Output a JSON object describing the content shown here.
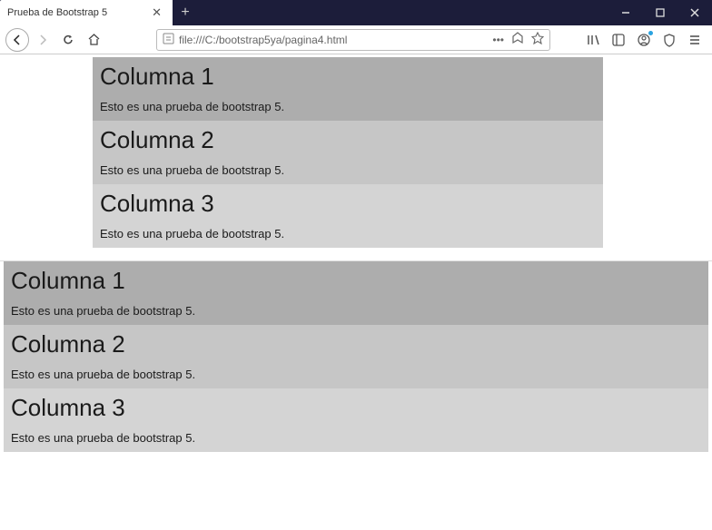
{
  "window": {
    "tab_title": "Prueba de Bootstrap 5",
    "url": "file:///C:/bootstrap5ya/pagina4.html"
  },
  "group1": {
    "cols": [
      {
        "title": "Columna 1",
        "text": "Esto es una prueba de bootstrap 5."
      },
      {
        "title": "Columna 2",
        "text": "Esto es una prueba de bootstrap 5."
      },
      {
        "title": "Columna 3",
        "text": "Esto es una prueba de bootstrap 5."
      }
    ]
  },
  "group2": {
    "cols": [
      {
        "title": "Columna 1",
        "text": "Esto es una prueba de bootstrap 5."
      },
      {
        "title": "Columna 2",
        "text": "Esto es una prueba de bootstrap 5."
      },
      {
        "title": "Columna 3",
        "text": "Esto es una prueba de bootstrap 5."
      }
    ]
  }
}
